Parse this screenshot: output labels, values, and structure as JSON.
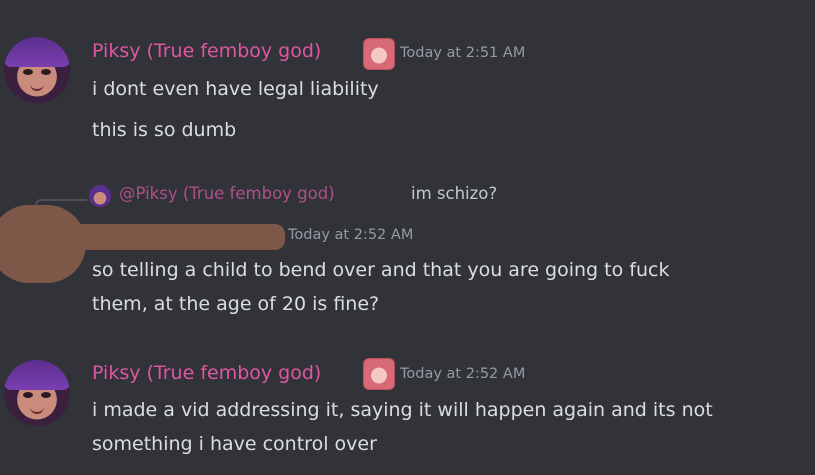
{
  "messages": [
    {
      "author": "Piksy (True femboy god)",
      "timestamp": "Today at 2:51 AM",
      "lines": [
        "i dont even have legal liability",
        "this is so dumb"
      ]
    },
    {
      "author": "",
      "timestamp": "Today at 2:52 AM",
      "reply": {
        "mention": "@Piksy (True femboy god)",
        "text": "im schizo?"
      },
      "lines": [
        "so telling a child to bend over and that you are going to fuck",
        "them, at the age of 20 is fine?"
      ]
    },
    {
      "author": "Piksy (True femboy god)",
      "timestamp": "Today at 2:52 AM",
      "lines": [
        "i made a vid addressing it, saying it will happen again and its not",
        "something i have control over"
      ]
    }
  ],
  "colors": {
    "background": "#313338",
    "username": "#e056a1",
    "mention": "#b0508a",
    "timestamp": "#949ba4",
    "text": "#dbdee1",
    "redaction": "#7d5848"
  },
  "icons": [
    "avatar",
    "role-badge-icon",
    "reply-avatar"
  ]
}
